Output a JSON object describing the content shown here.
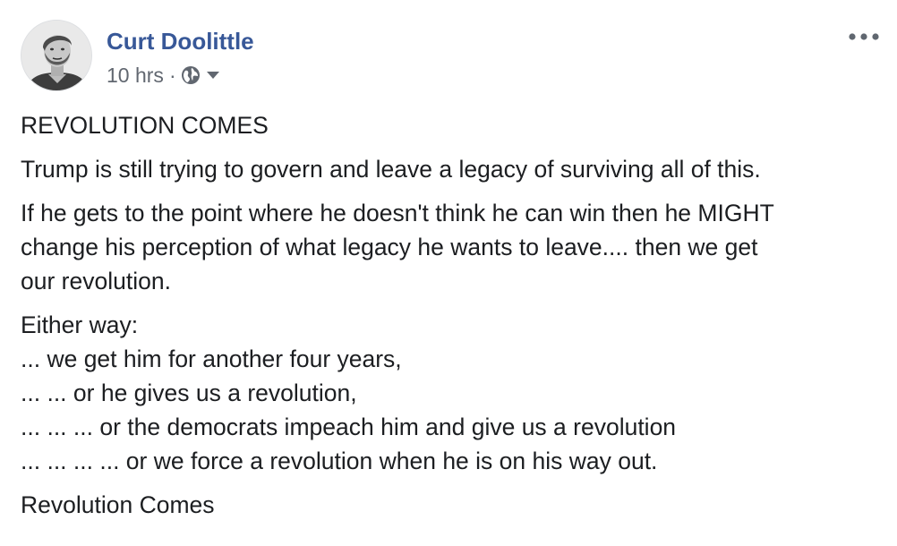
{
  "post": {
    "author": {
      "name": "Curt Doolittle"
    },
    "meta": {
      "time": "10 hrs",
      "separator": "·",
      "audience_icon": "globe-icon",
      "menu_icon": "caret-down-icon"
    },
    "more_menu_icon": "ellipsis-icon",
    "body": {
      "title": "REVOLUTION COMES",
      "paragraph1": "Trump is still trying to govern and leave a legacy of surviving all of this.",
      "paragraph2_lines": [
        "If he gets to the point where he doesn't think he can win then he MIGHT",
        "change his perception of what legacy he wants to leave.... then we get",
        "our revolution."
      ],
      "list_intro": "Either way:",
      "list_lines": [
        "... we get him for another four years,",
        "... ... or he gives us a revolution,",
        "... ... ... or the democrats impeach him and give us a revolution",
        "... ... ... ... or we force a revolution when he is on his way out."
      ],
      "closing": "Revolution Comes"
    },
    "colors": {
      "name_link": "#385898",
      "meta_text": "#616770",
      "body_text": "#1c1e21"
    }
  }
}
